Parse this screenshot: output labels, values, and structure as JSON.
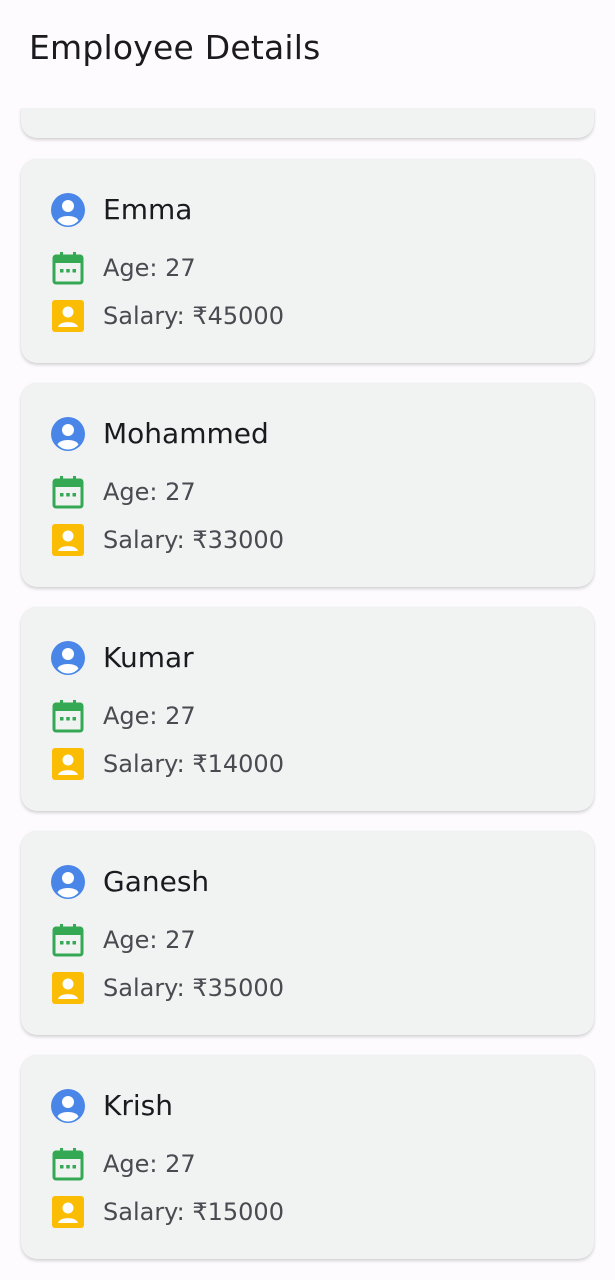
{
  "app_bar": {
    "title": "Employee Details"
  },
  "icons": {
    "person": "account-circle-icon",
    "age": "calendar-icon",
    "salary": "badge-icon"
  },
  "colors": {
    "person_icon": "#4a86e8",
    "age_icon": "#34a853",
    "salary_icon": "#fbbc04",
    "card_background": "#f1f3f3"
  },
  "employees": [
    {
      "name": "Emma",
      "age": "Age: 27",
      "salary": "Salary: ₹45000"
    },
    {
      "name": "Mohammed",
      "age": "Age: 27",
      "salary": "Salary: ₹33000"
    },
    {
      "name": "Kumar",
      "age": "Age: 27",
      "salary": "Salary: ₹14000"
    },
    {
      "name": "Ganesh",
      "age": "Age: 27",
      "salary": "Salary: ₹35000"
    },
    {
      "name": "Krish",
      "age": "Age: 27",
      "salary": "Salary: ₹15000"
    }
  ]
}
